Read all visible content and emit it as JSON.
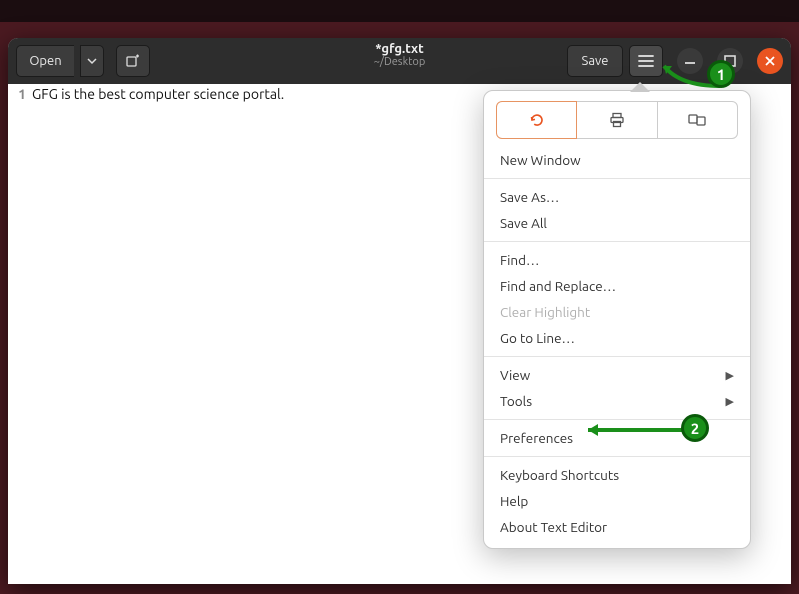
{
  "desktop": {
    "background_color": "#4b1a21"
  },
  "window": {
    "title": "*gfg.txt",
    "subtitle": "~/Desktop"
  },
  "titlebar": {
    "open_label": "Open",
    "save_label": "Save"
  },
  "editor": {
    "lines": [
      {
        "num": "1",
        "text": "GFG is the best computer science portal."
      }
    ]
  },
  "menu": {
    "new_window": "New Window",
    "save_as": "Save As…",
    "save_all": "Save All",
    "find": "Find…",
    "find_replace": "Find and Replace…",
    "clear_highlight": "Clear Highlight",
    "goto_line": "Go to Line…",
    "view": "View",
    "tools": "Tools",
    "preferences": "Preferences",
    "shortcuts": "Keyboard Shortcuts",
    "help": "Help",
    "about": "About Text Editor"
  },
  "annotations": {
    "one": "1",
    "two": "2"
  }
}
